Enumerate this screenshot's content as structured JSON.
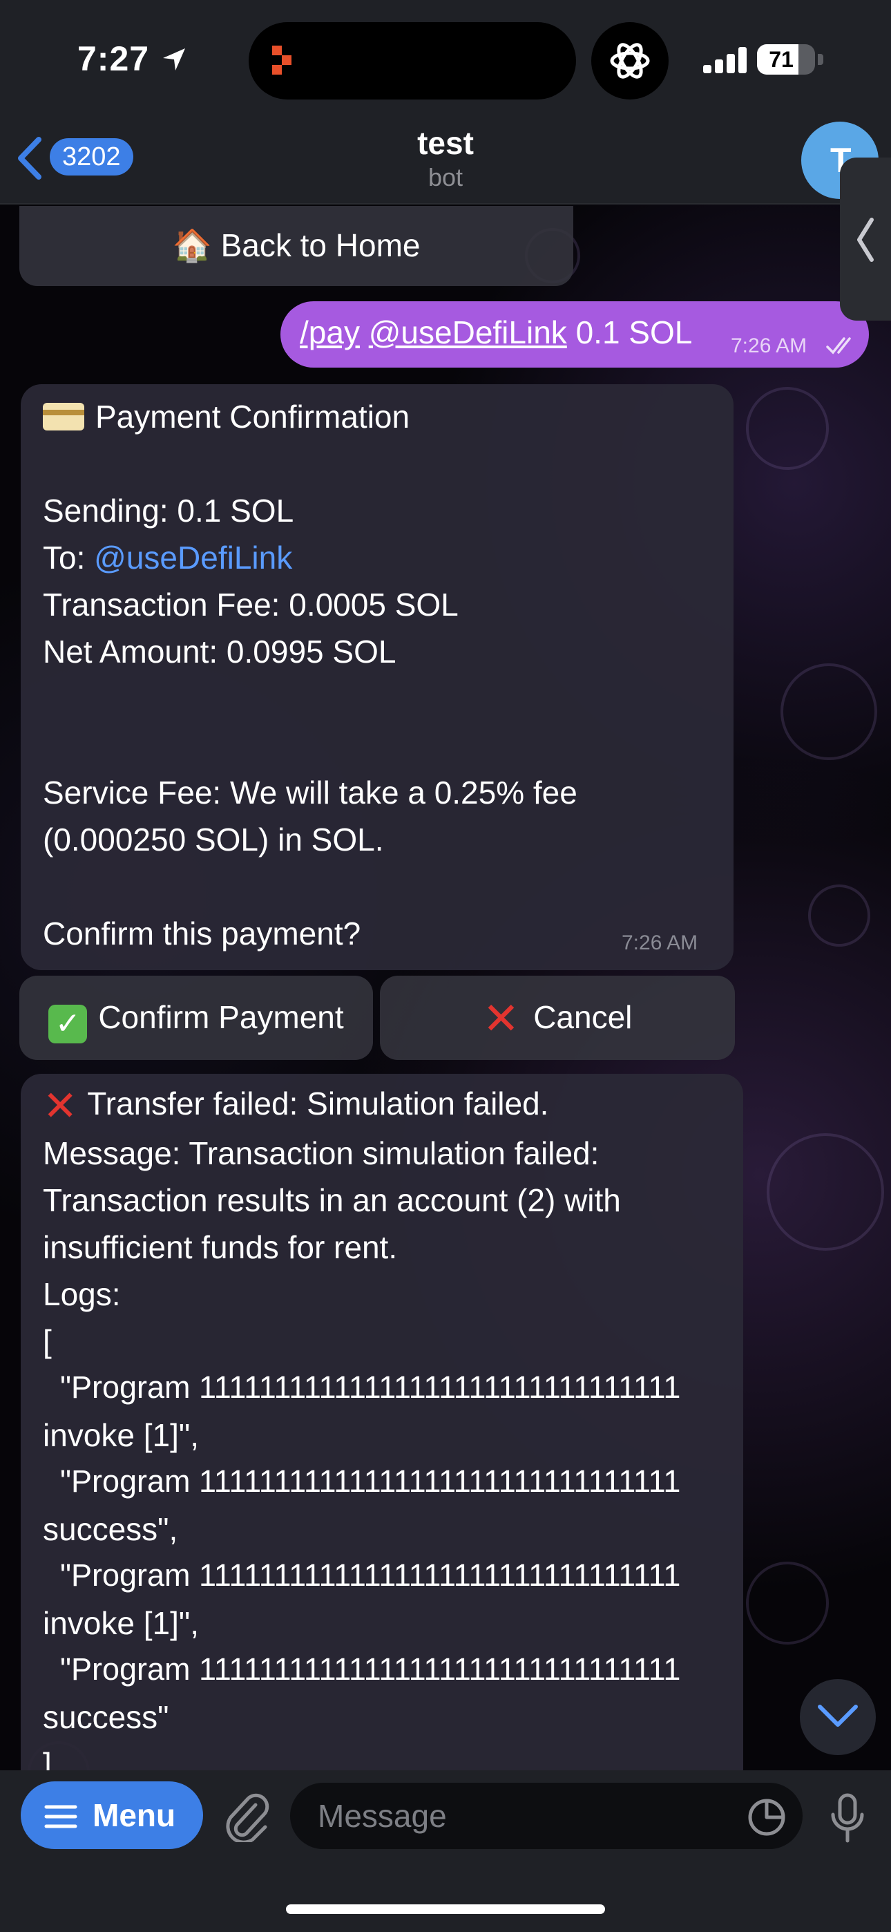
{
  "status_bar": {
    "time": "7:27",
    "battery": "71"
  },
  "header": {
    "back_count": "3202",
    "title": "test",
    "subtitle": "bot",
    "avatar_letter": "T"
  },
  "keyboard_top": {
    "back_home": "🏠 Back to Home"
  },
  "outgoing": {
    "command": "/pay",
    "mention": "@useDefiLink",
    "amount": "0.1 SOL",
    "time": "7:26 AM"
  },
  "confirmation": {
    "title": "Payment Confirmation",
    "sending": "Sending: 0.1 SOL",
    "to_prefix": "To: ",
    "to_mention": "@useDefiLink",
    "fee": "Transaction Fee: 0.0005 SOL",
    "net": "Net Amount: 0.0995 SOL",
    "service_fee_1": "Service Fee: We will take a 0.25% fee",
    "service_fee_2": "(0.000250 SOL) in SOL.",
    "question": "Confirm this payment?",
    "time": "7:26 AM"
  },
  "buttons": {
    "confirm": "Confirm Payment",
    "cancel": "Cancel"
  },
  "error_message": {
    "lines": [
      "Transfer failed: Simulation failed.",
      "Message: Transaction simulation failed:",
      "Transaction results in an account (2) with",
      "insufficient funds for rent.",
      "Logs:",
      "[",
      "  \"Program 11111111111111111111111111111111",
      "invoke [1]\",",
      "  \"Program 11111111111111111111111111111111",
      "success\",",
      "  \"Program 11111111111111111111111111111111",
      "invoke [1]\",",
      "  \"Program 11111111111111111111111111111111",
      "success\"",
      "]"
    ]
  },
  "input": {
    "menu_label": "Menu",
    "placeholder": "Message"
  },
  "colors": {
    "accent": "#3d7fe6",
    "outgoing_bubble": "#a65ae0",
    "link": "#5a9bff",
    "danger": "#e3342f",
    "success": "#58b94d"
  }
}
